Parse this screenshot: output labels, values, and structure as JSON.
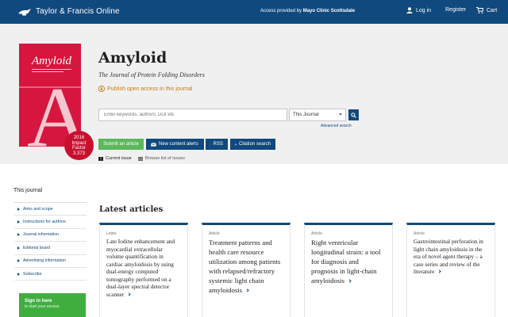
{
  "header": {
    "logo_text": "Taylor & Francis Online",
    "access_prefix": "Access provided by",
    "access_org": "Mayo Clinic Scottsdale",
    "login_label": "Log in",
    "register_label": "Register",
    "cart_label": "Cart"
  },
  "journal": {
    "cover_title": "Amyloid",
    "cover_letter": "A",
    "impact_year": "2016",
    "impact_label_1": "Impact",
    "impact_label_2": "Factor",
    "impact_value": "3.373",
    "title": "Amyloid",
    "subtitle": "The Journal of Protein Folding Disorders",
    "open_access_link": "Publish open access in this journal"
  },
  "search": {
    "placeholder": "Enter keywords, authors, DOI etc",
    "scope_value": "This Journal",
    "advanced_label": "Advanced search"
  },
  "actions": {
    "submit": "Submit an article",
    "alerts": "New content alerts",
    "rss": "RSS",
    "citation": "Citation search"
  },
  "issue_links": {
    "current": "Current issue",
    "browse": "Browse list of issues"
  },
  "sidebar": {
    "heading": "This journal",
    "items": [
      "Aims and scope",
      "Instructions for authors",
      "Journal information",
      "Editorial board",
      "Advertising information",
      "Subscribe"
    ],
    "signin_title": "Sign in here",
    "signin_sub": "to start your access"
  },
  "latest": {
    "heading": "Latest articles",
    "articles": [
      {
        "type": "Letter",
        "title": "Late Iodine enhancement and myocardial extracellular volume quantification in cardiac amyloidosis by using dual-energy computed tomography performed on a dual-layer spectral detector scanner"
      },
      {
        "type": "Article",
        "title": "Treatment patterns and health care resource utilization among patients with relapsed/refractory systemic light chain amyloidosis"
      },
      {
        "type": "Article",
        "title": "Right ventricular longitudinal strain: a tool for diagnosis and prognosis in light-chain amyloidosis"
      },
      {
        "type": "Article",
        "title": "Gastrointestinal perforation in light chain amyloidosis in the era of novel agent therapy – a case series and review of the literature"
      }
    ]
  },
  "colors": {
    "brand_navy": "#10497e",
    "cover_red": "#d6163e",
    "impact_red": "#c8102e",
    "submit_green": "#5cb85c",
    "oa_orange": "#c87914"
  }
}
